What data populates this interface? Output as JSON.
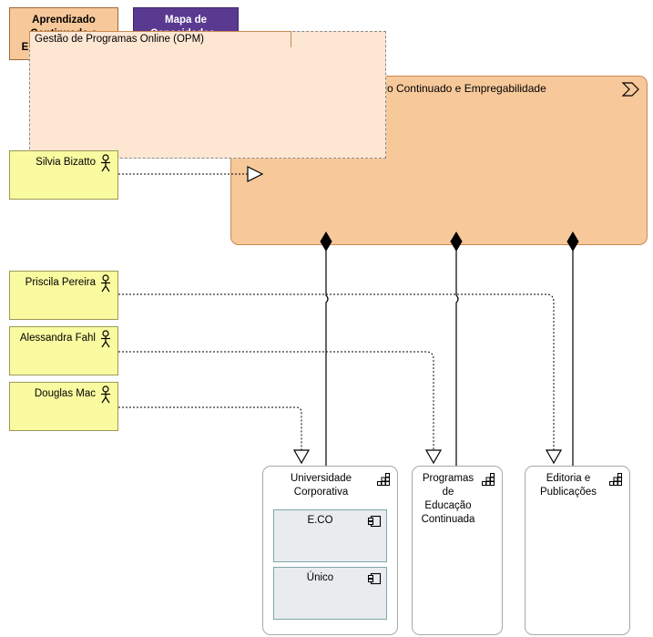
{
  "tabs": [
    {
      "label": "Aprendizado Continuado e Empregabilidade",
      "active": true,
      "color": "#f7c89a"
    },
    {
      "label": "Mapa de Capacidades - Visão Geral",
      "active": false,
      "color": "#5a3a91"
    }
  ],
  "capability": {
    "title": "Aprendizado Continuado e Empregabilidade",
    "icon": "value-stream-icon",
    "fill": "#f7c89a",
    "border": "#c98b4f",
    "sub_capability": {
      "label": "Gestão de Programas Online (OPM)",
      "fill": "#fde7d3",
      "border_style": "dashed"
    }
  },
  "actors": [
    {
      "name": "Silvia Bizatto",
      "icon": "actor-icon"
    },
    {
      "name": "Priscila Pereira",
      "icon": "actor-icon"
    },
    {
      "name": "Alessandra Fahl",
      "icon": "actor-icon"
    },
    {
      "name": "Douglas Mac",
      "icon": "actor-icon"
    }
  ],
  "capability_boxes": [
    {
      "title": "Universidade Corporativa",
      "icon": "capability-grid-icon",
      "components": [
        {
          "name": "E.CO",
          "icon": "component-icon"
        },
        {
          "name": "Único",
          "icon": "component-icon"
        }
      ]
    },
    {
      "title": "Programas de Educação Continuada",
      "icon": "capability-grid-icon",
      "components": []
    },
    {
      "title": "Editoria e Publicações",
      "icon": "capability-grid-icon",
      "components": []
    }
  ],
  "colors": {
    "accent_orange": "#f7c89a",
    "accent_purple": "#5a3a91",
    "actor_yellow": "#fafaa0",
    "component_gray": "#e8ecee",
    "line": "#000000"
  }
}
